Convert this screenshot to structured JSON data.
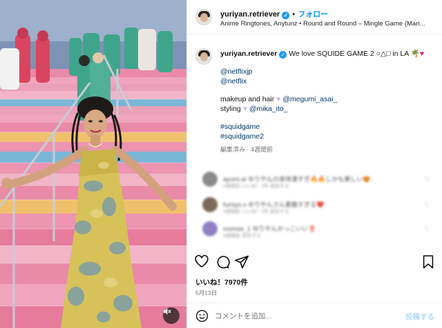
{
  "header": {
    "username": "yuriyan.retriever",
    "separator": "•",
    "follow_label": "フォロー",
    "music": "Anime Ringtones, Anytunz • Round and Round – Mingle Game (Mari..."
  },
  "caption": {
    "username": "yuriyan.retriever",
    "text": "We love SQUIDE GAME 2 ○△□ in LA",
    "mentions": [
      "@netflixjp",
      "@netflix"
    ],
    "makeup_label": "makeup and hair",
    "makeup_handle": "@megumi_asai_",
    "styling_label": "styling",
    "styling_handle": "@mika_ito_",
    "hashtags": [
      "#squidgame",
      "#squidgame2"
    ],
    "meta": "編集済み · 4週間前"
  },
  "comments": [
    {
      "avatar_color": "#8a8a8a",
      "text": "ayumi.ai ゆりやんの身体凄すぎ🔥🔥しかも美しい😍",
      "sub": "4週間前 いいね！1件 返信する"
    },
    {
      "avatar_color": "#7c6a58",
      "text": "fumiyo.s ゆりやんさん素敵すぎる❤️",
      "sub": "4週間前 いいね！2件 返信する"
    },
    {
      "avatar_color": "#8f7fc6",
      "text": "momoe_1 ゆりやんかっこいい‼️",
      "sub": "4週間前 返信する"
    }
  ],
  "likes": "いいね！7970件",
  "date": "5月13日",
  "add_comment": {
    "placeholder": "コメントを追加...",
    "post_label": "投稿する"
  },
  "colors": {
    "accent": "#0095f6",
    "link": "#00376b",
    "like_red": "#e0245e",
    "verified": "#1d9bf0"
  },
  "icons": [
    "mute-icon",
    "heart-icon",
    "comment-icon",
    "share-icon",
    "bookmark-icon",
    "emoji-icon",
    "verified-badge-icon"
  ]
}
